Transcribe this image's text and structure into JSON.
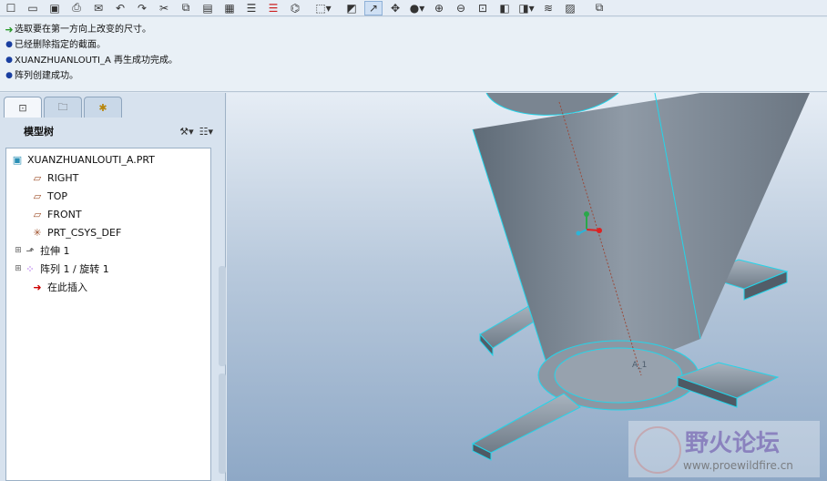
{
  "toolbar": {
    "icons": [
      "new-file-icon",
      "open-file-icon",
      "save-icon",
      "print-icon",
      "send-icon",
      "undo-icon",
      "redo-icon",
      "cut-icon",
      "copy-icon",
      "paste-icon",
      "layers-icon",
      "list-icon",
      "list-red-icon",
      "binoculars-icon",
      "box-select-icon",
      "repaint-icon",
      "spin-icon",
      "orient-icon",
      "sphere-icon",
      "zoom-in-icon",
      "zoom-out-icon",
      "zoom-fit-icon",
      "view-icon",
      "view2-icon",
      "layers2-icon",
      "image-icon",
      "window-icon"
    ]
  },
  "messages": [
    {
      "type": "prompt",
      "text": "选取要在第一方向上改变的尺寸。"
    },
    {
      "type": "info",
      "text": "已经删除指定的截面。"
    },
    {
      "type": "info",
      "text": "XUANZHUANLOUTI_A 再生成功完成。"
    },
    {
      "type": "info",
      "text": "阵列创建成功。"
    }
  ],
  "tabs": [
    {
      "icon": "model-tree-icon",
      "active": true
    },
    {
      "icon": "folder-browser-icon",
      "active": false
    },
    {
      "icon": "favorites-icon",
      "active": false
    }
  ],
  "tree_panel": {
    "title": "模型树",
    "settings_icon": "tools-icon",
    "show_icon": "show-list-icon",
    "items": [
      {
        "label": "XUANZHUANLOUTI_A.PRT",
        "icon": "part-icon",
        "indent": 0,
        "expandable": false
      },
      {
        "label": "RIGHT",
        "icon": "datum-plane-icon",
        "indent": 1,
        "expandable": false
      },
      {
        "label": "TOP",
        "icon": "datum-plane-icon",
        "indent": 1,
        "expandable": false
      },
      {
        "label": "FRONT",
        "icon": "datum-plane-icon",
        "indent": 1,
        "expandable": false
      },
      {
        "label": "PRT_CSYS_DEF",
        "icon": "csys-icon",
        "indent": 1,
        "expandable": false
      },
      {
        "label": "拉伸 1",
        "icon": "extrude-icon",
        "indent": 1,
        "expandable": true
      },
      {
        "label": "阵列 1 / 旋转 1",
        "icon": "pattern-icon",
        "indent": 1,
        "expandable": true
      },
      {
        "label": "在此插入",
        "icon": "insert-arrow-icon",
        "indent": 1,
        "expandable": false
      }
    ]
  },
  "viewport": {
    "axis_label": "A_1",
    "watermark_title": "野火论坛",
    "watermark_url": "www.proewildfire.cn"
  }
}
